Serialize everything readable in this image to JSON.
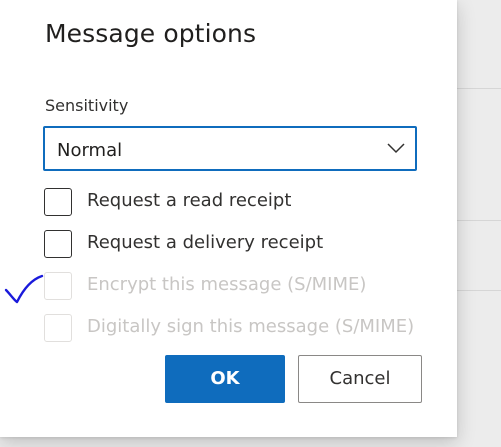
{
  "dialog": {
    "title": "Message options"
  },
  "sensitivity": {
    "label": "Sensitivity",
    "selected": "Normal"
  },
  "options": [
    {
      "label": "Request a read receipt",
      "checked": false,
      "disabled": false
    },
    {
      "label": "Request a delivery receipt",
      "checked": false,
      "disabled": false
    },
    {
      "label": "Encrypt this message (S/MIME)",
      "checked": false,
      "disabled": true
    },
    {
      "label": "Digitally sign this message (S/MIME)",
      "checked": false,
      "disabled": true
    }
  ],
  "buttons": {
    "ok_label": "OK",
    "cancel_label": "Cancel"
  },
  "colors": {
    "accent": "#0f6cbd",
    "annotation": "#1a1adb"
  },
  "icons": {
    "dropdown": "chevron-down-icon",
    "annotation": "checkmark-scribble"
  }
}
